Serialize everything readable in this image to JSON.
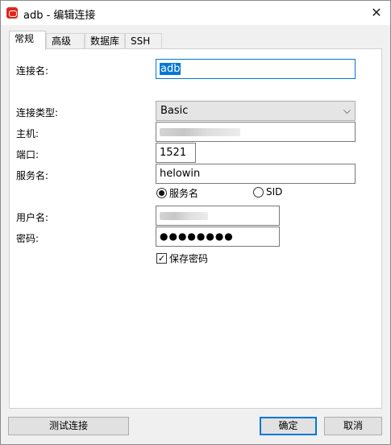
{
  "window": {
    "title": "adb - 编辑连接",
    "close_glyph": "✕"
  },
  "tabs": [
    {
      "label": "常规",
      "active": true
    },
    {
      "label": "高级",
      "active": false
    },
    {
      "label": "数据库",
      "active": false
    },
    {
      "label": "SSH",
      "active": false
    }
  ],
  "form": {
    "connection_name_label": "连接名:",
    "connection_name_value": "adb",
    "connection_type_label": "连接类型:",
    "connection_type_value": "Basic",
    "host_label": "主机:",
    "port_label": "端口:",
    "port_value": "1521",
    "service_name_label": "服务名:",
    "service_name_value": "helowin",
    "radio_service_name": "服务名",
    "radio_service_name_selected": true,
    "radio_sid": "SID",
    "radio_sid_selected": false,
    "username_label": "用户名:",
    "password_label": "密码:",
    "password_value": "●●●●●●●●",
    "save_password_label": "保存密码",
    "save_password_checked": true
  },
  "buttons": {
    "test_connection": "测试连接",
    "ok": "确定",
    "cancel": "取消"
  },
  "colors": {
    "accent": "#0078d7",
    "app_icon": "#e1261c"
  }
}
